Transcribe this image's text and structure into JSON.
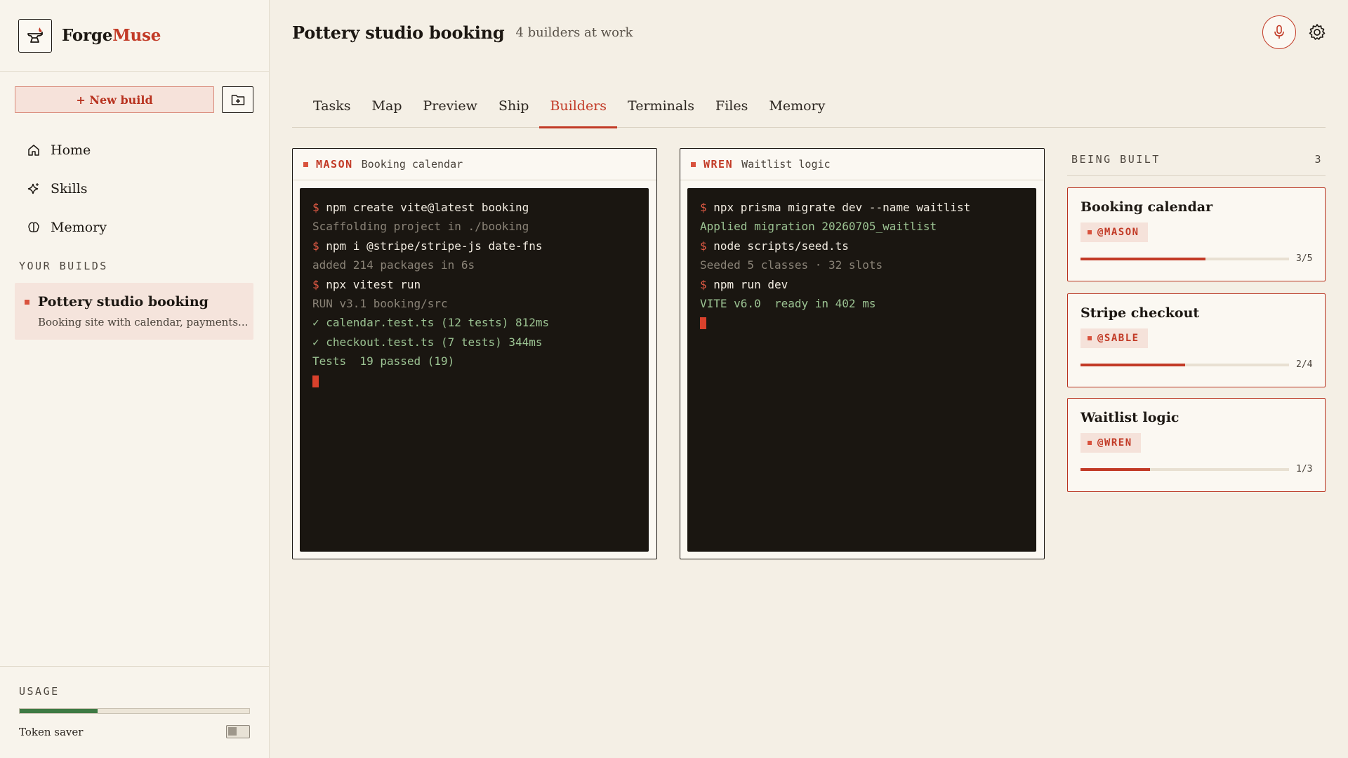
{
  "brand": {
    "name_part1": "Forge",
    "name_part2": "Muse",
    "logo_icon": "anvil-flame-icon"
  },
  "sidebar": {
    "new_build_label": "+ New build",
    "nav": [
      {
        "label": "Home",
        "icon": "home-icon"
      },
      {
        "label": "Skills",
        "icon": "sparkle-icon"
      },
      {
        "label": "Memory",
        "icon": "brain-icon"
      }
    ],
    "builds_label": "YOUR BUILDS",
    "builds": [
      {
        "title": "Pottery studio booking",
        "description": "Booking site with calendar, payments..."
      }
    ],
    "usage_label": "USAGE",
    "usage_fraction": 0.34,
    "token_saver_label": "Token saver",
    "token_saver_on": false
  },
  "header": {
    "title": "Pottery studio booking",
    "subtitle": "4 builders at work"
  },
  "tabs": [
    "Tasks",
    "Map",
    "Preview",
    "Ship",
    "Builders",
    "Terminals",
    "Files",
    "Memory"
  ],
  "active_tab": "Builders",
  "terminals": [
    {
      "builder": "MASON",
      "task": "Booking calendar",
      "lines": [
        {
          "type": "cmd",
          "text": "npm create vite@latest booking"
        },
        {
          "type": "dim",
          "text": "Scaffolding project in ./booking"
        },
        {
          "type": "cmd",
          "text": "npm i @stripe/stripe-js date-fns"
        },
        {
          "type": "dim",
          "text": "added 214 packages in 6s"
        },
        {
          "type": "cmd",
          "text": "npx vitest run"
        },
        {
          "type": "dim",
          "text": "RUN v3.1 booking/src"
        },
        {
          "type": "ok",
          "text": "✓ calendar.test.ts (12 tests) 812ms"
        },
        {
          "type": "ok",
          "text": "✓ checkout.test.ts (7 tests) 344ms"
        },
        {
          "type": "ok",
          "text": "Tests  19 passed (19)"
        }
      ]
    },
    {
      "builder": "WREN",
      "task": "Waitlist logic",
      "lines": [
        {
          "type": "cmd",
          "text": "npx prisma migrate dev --name waitlist"
        },
        {
          "type": "ok",
          "text": "Applied migration 20260705_waitlist"
        },
        {
          "type": "cmd",
          "text": "node scripts/seed.ts"
        },
        {
          "type": "dim",
          "text": "Seeded 5 classes · 32 slots"
        },
        {
          "type": "cmd",
          "text": "npm run dev"
        },
        {
          "type": "ok",
          "text": "VITE v6.0  ready in 402 ms"
        }
      ]
    }
  ],
  "being_built": {
    "label": "BEING BUILT",
    "count": "3",
    "items": [
      {
        "title": "Booking calendar",
        "tag": "@MASON",
        "done": 3,
        "total": 5,
        "count_label": "3/5"
      },
      {
        "title": "Stripe checkout",
        "tag": "@SABLE",
        "done": 2,
        "total": 4,
        "count_label": "2/4"
      },
      {
        "title": "Waitlist logic",
        "tag": "@WREN",
        "done": 1,
        "total": 3,
        "count_label": "1/3"
      }
    ]
  },
  "colors": {
    "accent": "#c23a26",
    "background": "#f4efe5",
    "terminal_bg": "#1a1611",
    "usage_fill": "#3e7a44"
  }
}
